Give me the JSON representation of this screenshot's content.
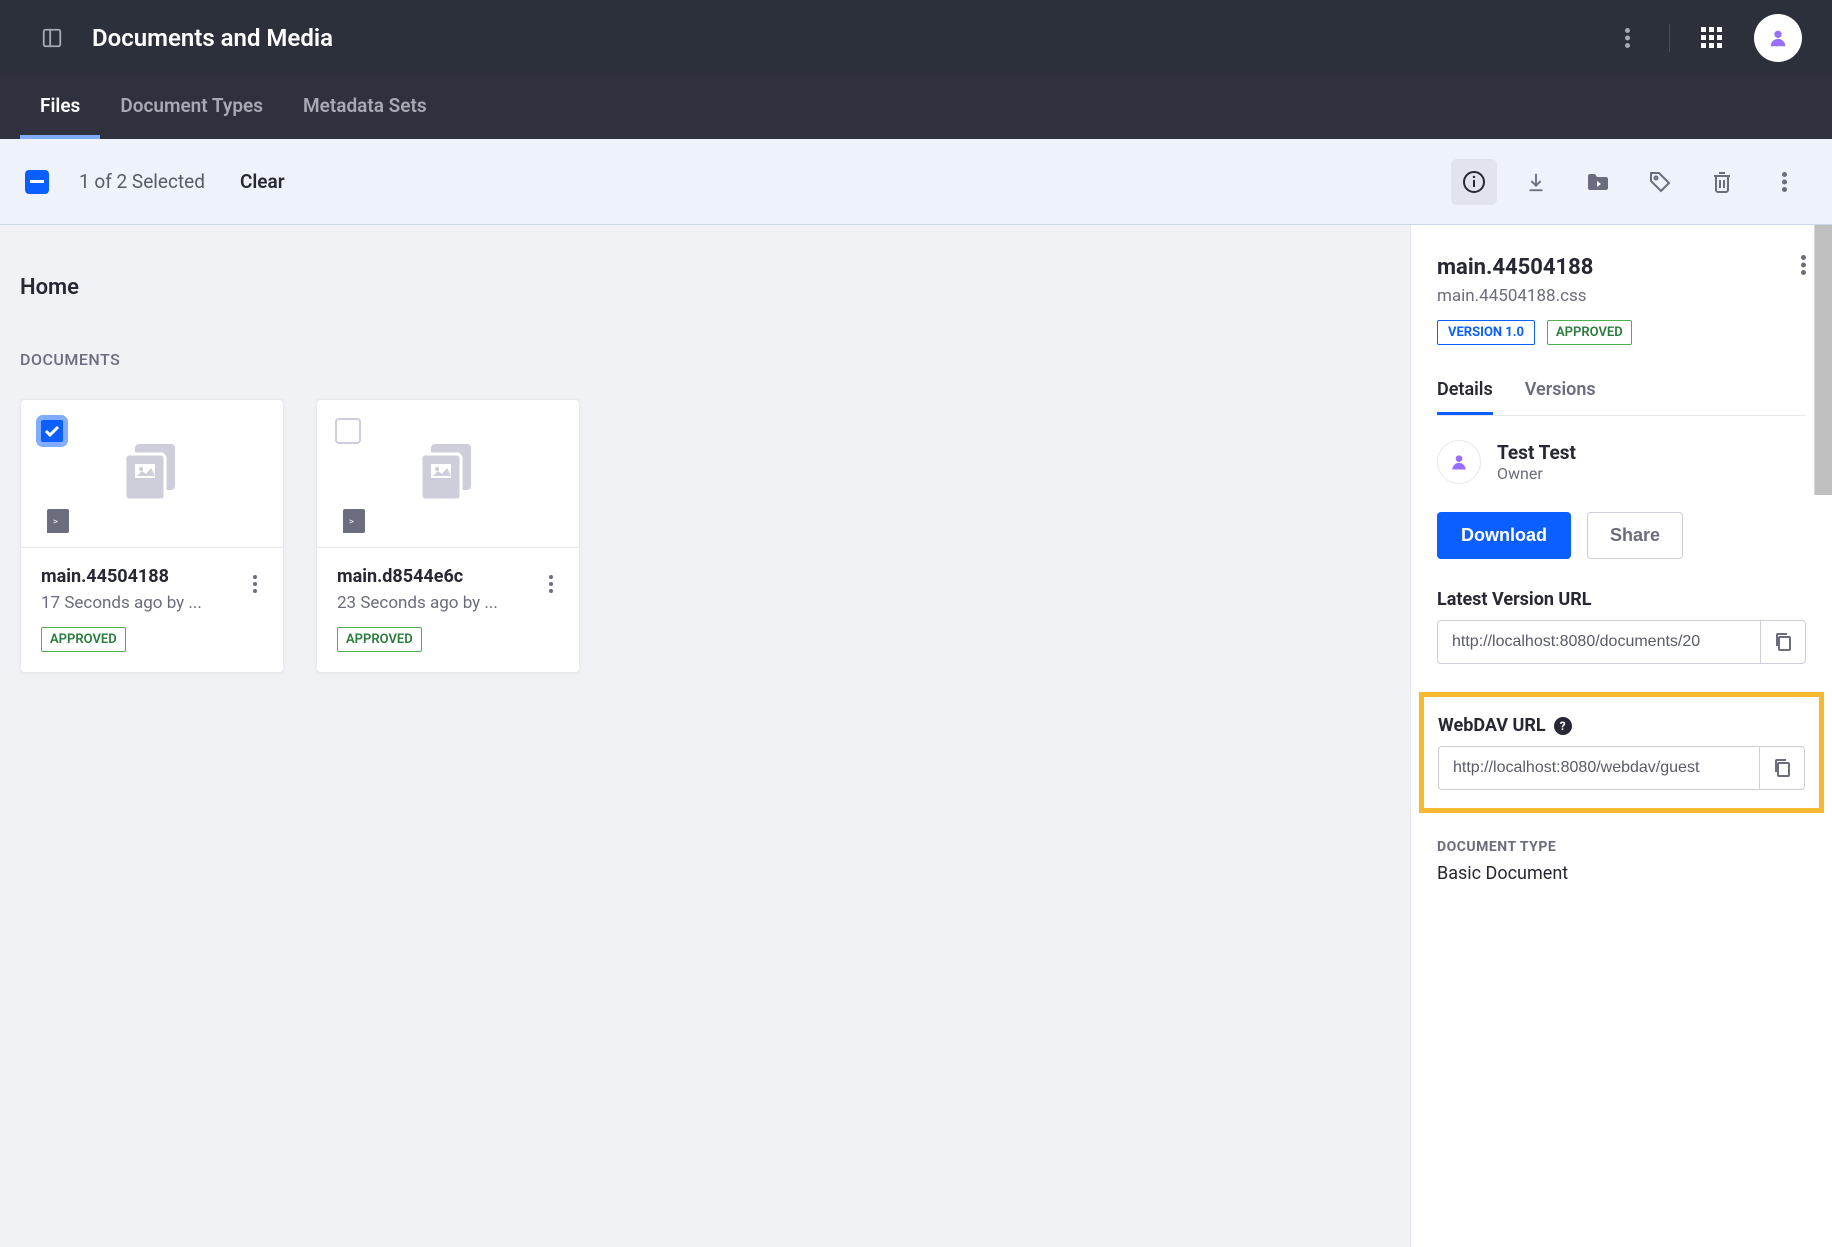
{
  "header": {
    "title": "Documents and Media"
  },
  "tabs": [
    {
      "label": "Files",
      "active": true
    },
    {
      "label": "Document Types",
      "active": false
    },
    {
      "label": "Metadata Sets",
      "active": false
    }
  ],
  "selection": {
    "count_text": "1 of 2 Selected",
    "clear_label": "Clear"
  },
  "breadcrumb": "Home",
  "section_label": "DOCUMENTS",
  "documents": [
    {
      "title": "main.44504188",
      "subtitle": "17 Seconds ago by ...",
      "status": "APPROVED",
      "checked": true
    },
    {
      "title": "main.d8544e6c",
      "subtitle": "23 Seconds ago by ...",
      "status": "APPROVED",
      "checked": false
    }
  ],
  "side_panel": {
    "title": "main.44504188",
    "filename": "main.44504188.css",
    "version_badge": "VERSION 1.0",
    "status_badge": "APPROVED",
    "tabs": {
      "details": "Details",
      "versions": "Versions"
    },
    "owner": {
      "name": "Test Test",
      "role": "Owner"
    },
    "download_label": "Download",
    "share_label": "Share",
    "latest_url_label": "Latest Version URL",
    "latest_url_value": "http://localhost:8080/documents/20",
    "webdav_label": "WebDAV URL",
    "webdav_value": "http://localhost:8080/webdav/guest",
    "doc_type_label": "DOCUMENT TYPE",
    "doc_type_value": "Basic Document"
  }
}
